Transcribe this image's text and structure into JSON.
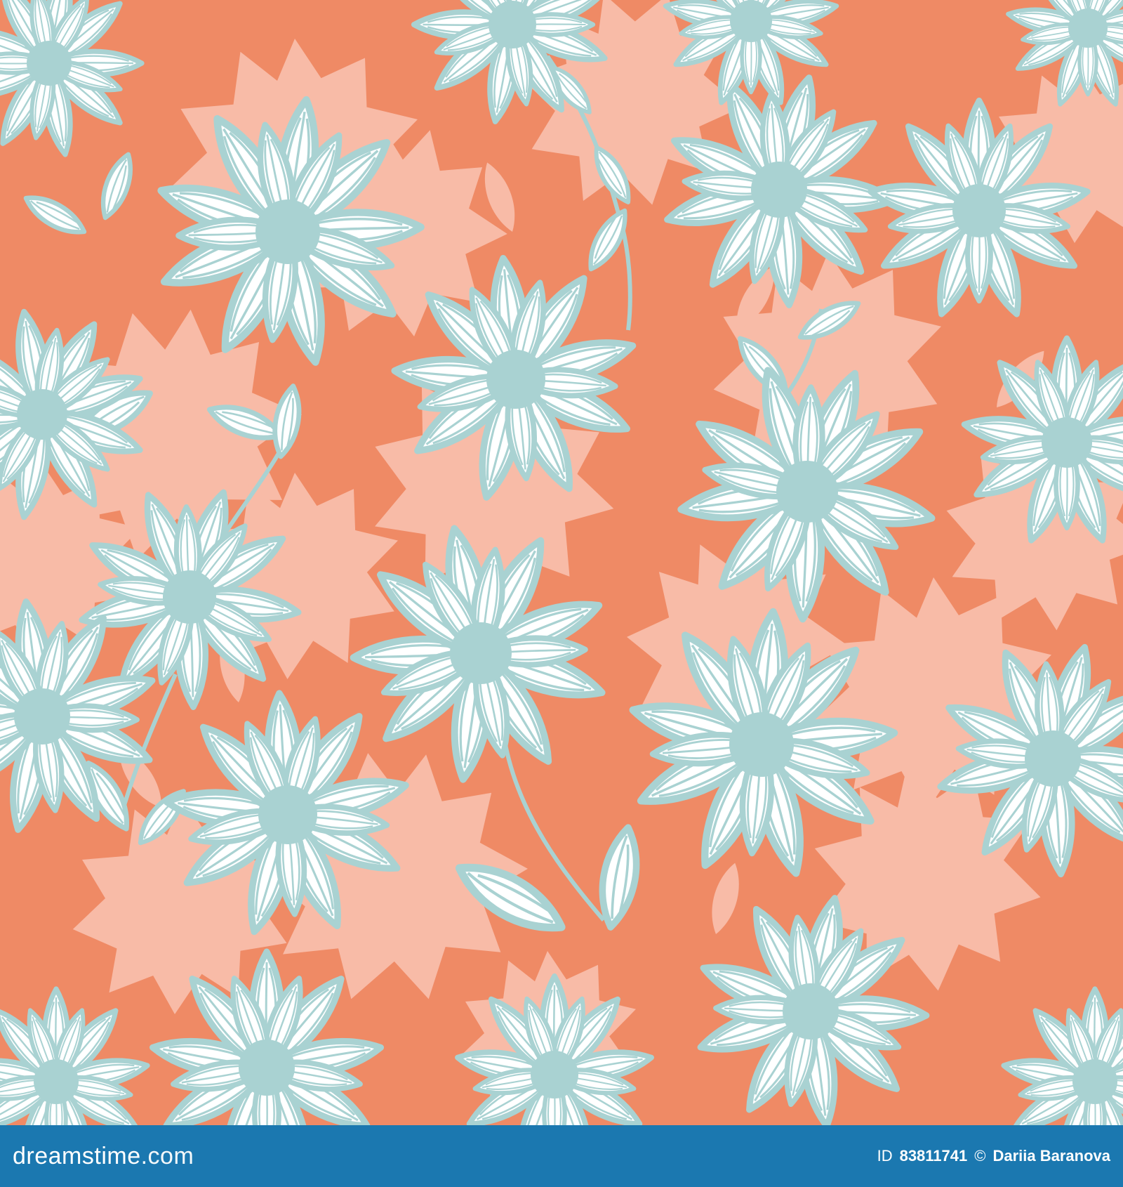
{
  "image": {
    "kind": "seamless floral pattern",
    "colors": {
      "background": "#ef8a65",
      "silhouette": "#f8bba7",
      "petal_fill": "#ffffff",
      "petal_outline": "#a9d2d2",
      "flower_center": "#a9d2d2",
      "footer_band": "#1b78b0"
    }
  },
  "footer": {
    "brand_name": "dreamstime",
    "brand_tld": ".com",
    "id_label": "ID",
    "id_number": "83811741",
    "copyright": "©",
    "author": "Dariia Baranova"
  }
}
